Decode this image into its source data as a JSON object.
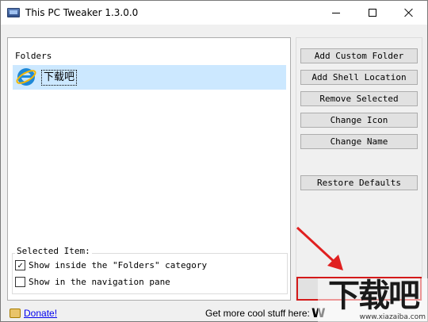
{
  "window": {
    "title": "This PC Tweaker 1.3.0.0"
  },
  "folders": {
    "label": "Folders",
    "items": [
      {
        "name": "下载吧",
        "icon": "internet-explorer-icon",
        "selected": true
      }
    ]
  },
  "selected_item": {
    "label": "Selected Item:",
    "options": [
      {
        "label": "Show inside the \"Folders\" category",
        "checked": true
      },
      {
        "label": "Show in the navigation pane",
        "checked": false
      }
    ]
  },
  "actions": {
    "add_custom_folder": "Add Custom Folder",
    "add_shell_location": "Add Shell Location",
    "remove_selected": "Remove Selected",
    "change_icon": "Change Icon",
    "change_name": "Change Name",
    "restore_defaults": "Restore Defaults"
  },
  "footer": {
    "donate": "Donate!",
    "more_text": "Get more cool stuff here:",
    "more_link_glyph": "W"
  },
  "watermark": {
    "logo_text": "下载吧",
    "url": "www.xiazaiba.com"
  },
  "colors": {
    "selection": "#cce8ff",
    "highlight_border": "#d41a1a",
    "arrow": "#e02020",
    "link": "#0000ee"
  }
}
